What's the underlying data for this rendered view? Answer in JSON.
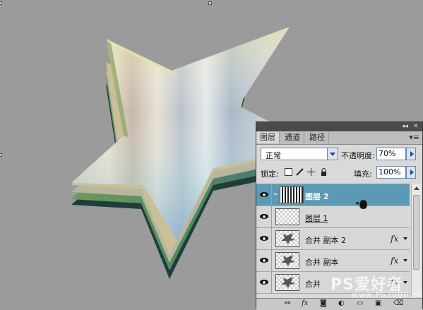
{
  "panel": {
    "tabs": [
      {
        "label": "图层",
        "active": true
      },
      {
        "label": "通道",
        "active": false
      },
      {
        "label": "路径",
        "active": false
      }
    ],
    "collapse_glyph": "◂◂",
    "close_glyph": "✕",
    "menu_glyph": "▾≡",
    "blend_mode": "正常",
    "opacity_label": "不透明度:",
    "opacity_value": "70%",
    "lock_label": "锁定:",
    "fill_label": "填充:",
    "fill_value": "100%",
    "layers": [
      {
        "name": "图层 2",
        "selected": true,
        "fx": false,
        "thumb": "stripes"
      },
      {
        "name": "图层 1",
        "selected": false,
        "fx": false,
        "thumb": "transparent"
      },
      {
        "name": "合并 副本 2",
        "selected": false,
        "fx": true,
        "thumb": "star"
      },
      {
        "name": "合并 副本",
        "selected": false,
        "fx": true,
        "thumb": "star"
      },
      {
        "name": "合并",
        "selected": false,
        "fx": true,
        "thumb": "star"
      }
    ],
    "fx_label": "fx",
    "footer_icons": [
      "link-icon",
      "fx-icon",
      "mask-icon",
      "adjustment-icon",
      "folder-icon",
      "new-layer-icon",
      "trash-icon"
    ]
  },
  "watermark": {
    "main": "PS爱好者",
    "sub": "www.PS2000.cn"
  },
  "colors": {
    "canvas_bg": "#9b9b9b",
    "selected_layer": "#5b9ab5",
    "panel_bg": "#d9d9d9"
  }
}
